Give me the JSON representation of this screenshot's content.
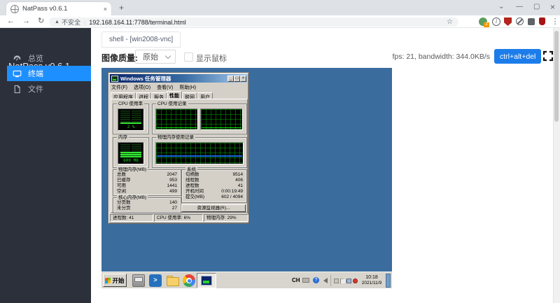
{
  "browser": {
    "tab_title": "NatPass v0.6.1",
    "security_warning": "不安全",
    "url": "192.168.164.11:7788/terminal.html",
    "extension_badge": "2"
  },
  "icons": {
    "close": "×",
    "new_tab": "+",
    "back": "←",
    "forward": "→",
    "reload": "↻",
    "warning": "▲",
    "divider": "|",
    "star": "☆",
    "menu_dots": "⋮",
    "chevron_down": "⌄",
    "minimize": "—",
    "maximize": "▢",
    "info": "i",
    "help": "?",
    "powershell": ">",
    "tm_min": "_",
    "tm_max": "□",
    "tm_close": "×"
  },
  "sidebar": {
    "title": "NatPass v0.6.1",
    "items": [
      {
        "label": "总览"
      },
      {
        "label": "终端"
      },
      {
        "label": "文件"
      }
    ]
  },
  "toolbar": {
    "session_tab": "shell - [win2008-vnc]",
    "quality_label": "图像质量:",
    "quality_value": "原始",
    "show_mouse_label": "显示鼠标",
    "stats": "fps: 21, bandwidth: 344.0KB/s",
    "cad_button": "ctrl+alt+del"
  },
  "taskmgr": {
    "title": "Windows 任务管理器",
    "menus": [
      {
        "label": "文件(F)"
      },
      {
        "label": "选项(O)"
      },
      {
        "label": "查看(V)"
      },
      {
        "label": "帮助(H)"
      }
    ],
    "tabs": [
      {
        "label": "应用程序"
      },
      {
        "label": "进程"
      },
      {
        "label": "服务"
      },
      {
        "label": "性能"
      },
      {
        "label": "联网"
      },
      {
        "label": "用户"
      }
    ],
    "active_tab": "性能",
    "cpu_gauge": {
      "title": "CPU 使用率",
      "value": "2 %"
    },
    "cpu_history": {
      "title": "CPU 使用记录"
    },
    "mem_gauge": {
      "title": "内存",
      "value": "600 MB"
    },
    "mem_history": {
      "title": "物理内存使用记录"
    },
    "phys_mem": {
      "title": "物理内存(MB)",
      "rows": [
        {
          "label": "总数",
          "value": "2047"
        },
        {
          "label": "已缓存",
          "value": "953"
        },
        {
          "label": "可用",
          "value": "1441"
        },
        {
          "label": "空闲",
          "value": "499"
        }
      ]
    },
    "system": {
      "title": "系统",
      "rows": [
        {
          "label": "句柄数",
          "value": "9514"
        },
        {
          "label": "线程数",
          "value": "406"
        },
        {
          "label": "进程数",
          "value": "41"
        },
        {
          "label": "开机时间",
          "value": "0:00:19:49"
        },
        {
          "label": "提交(MB)",
          "value": "602 / 4094"
        }
      ]
    },
    "kernel_mem": {
      "title": "核心内存(MB)",
      "rows": [
        {
          "label": "分页数",
          "value": "140"
        },
        {
          "label": "未分页",
          "value": "27"
        }
      ]
    },
    "resmon_button": "资源监视器(R)...",
    "status_cells": [
      {
        "text": "进程数: 41"
      },
      {
        "text": "CPU 使用率: 6%"
      },
      {
        "text": "物理内存: 29%"
      }
    ]
  },
  "taskbar": {
    "start_label": "开始",
    "lang_indicator": "CH",
    "time": "10:18",
    "date": "2021/11/9"
  },
  "colors": {
    "sidebar_accent_blue": "#1e8fff",
    "cad_button_blue": "#1c7dea",
    "desktop_blue": "#3a6d9e",
    "gauge_green": "#18d418",
    "memory_line_blue": "#1668dc"
  }
}
